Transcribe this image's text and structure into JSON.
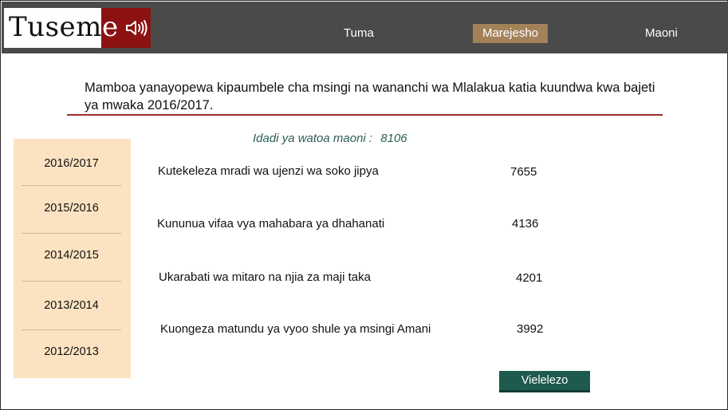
{
  "app": {
    "logo_text": "Tusem",
    "logo_accent_letter": "e",
    "logo_icon": "speaker-icon"
  },
  "nav": {
    "items": [
      {
        "label": "Tuma",
        "active": false
      },
      {
        "label": "Marejesho",
        "active": true
      },
      {
        "label": "Maoni",
        "active": false
      }
    ]
  },
  "headline": "Mamboa yanayopewa kipaumbele cha msingi na wananchi wa Mlalakua katia kuundwa kwa bajeti ya mwaka 2016/2017.",
  "respondents": {
    "label": "Idadi ya watoa maoni :",
    "value": "8106"
  },
  "years": [
    "2016/2017",
    "2015/2016",
    "2014/2015",
    "2013/2014",
    "2012/2013"
  ],
  "priorities": [
    {
      "label": "Kutekeleza mradi wa ujenzi wa soko jipya",
      "value": "7655"
    },
    {
      "label": "Kununua vifaa vya mahabara ya dhahanati",
      "value": "4136"
    },
    {
      "label": "Ukarabati wa mitaro na njia za maji taka",
      "value": "4201"
    },
    {
      "label": "Kuongeza matundu ya vyoo shule ya msingi Amani",
      "value": "3992"
    }
  ],
  "button": {
    "label": "Vielelezo"
  },
  "colors": {
    "topbar": "#4a4a4a",
    "logo_accent": "#8c1111",
    "nav_active": "#a3825a",
    "rule": "#a02a2a",
    "sidebar": "#fbe3c2",
    "count_text": "#2b5e55",
    "button": "#1e5a4e"
  }
}
